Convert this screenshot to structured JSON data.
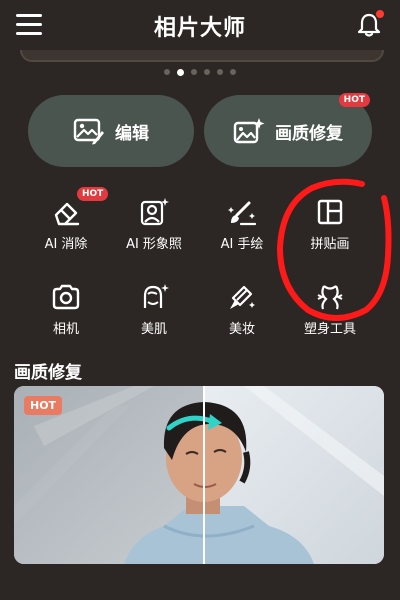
{
  "header": {
    "title": "相片大师",
    "menu_icon": "menu-icon",
    "bell_icon": "bell-icon"
  },
  "carousel": {
    "dots": 6,
    "active_index": 1
  },
  "quick_actions": [
    {
      "label": "编辑",
      "icon": "image-edit-icon"
    },
    {
      "label": "画质修复",
      "icon": "image-sparkle-icon",
      "badge": "HOT"
    }
  ],
  "tools": [
    {
      "label": "AI 消除",
      "icon": "eraser-icon",
      "badge": "HOT"
    },
    {
      "label": "AI 形象照",
      "icon": "portrait-sparkle-icon"
    },
    {
      "label": "AI 手绘",
      "icon": "brush-sparkle-icon"
    },
    {
      "label": "拼贴画",
      "icon": "collage-icon"
    },
    {
      "label": "相机",
      "icon": "camera-icon"
    },
    {
      "label": "美肌",
      "icon": "face-sparkle-icon"
    },
    {
      "label": "美妆",
      "icon": "lipstick-icon"
    },
    {
      "label": "塑身工具",
      "icon": "body-shape-icon"
    }
  ],
  "feature_section": {
    "title": "画质修复",
    "badge": "HOT"
  },
  "colors": {
    "background": "#2c2724",
    "button_bg": "#4a554f",
    "badge_red": "#e3393f",
    "annotation": "#ff1a1a"
  }
}
